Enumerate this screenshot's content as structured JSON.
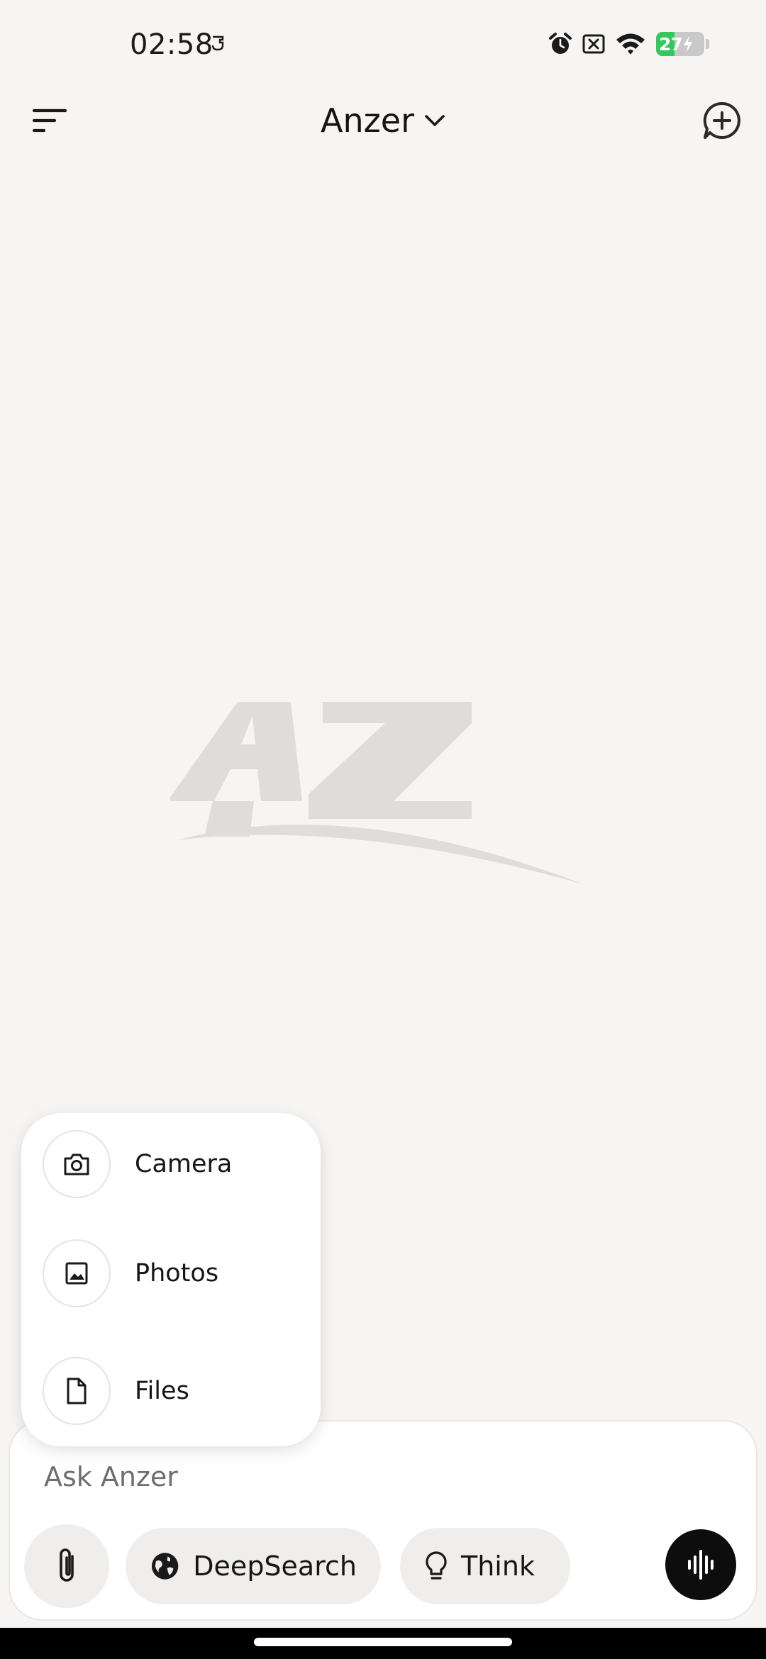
{
  "status_bar": {
    "time": "02:58",
    "battery_level": "27",
    "icons": [
      "alarm-icon",
      "no-sim-icon",
      "wifi-icon",
      "battery-charging-icon"
    ]
  },
  "header": {
    "title": "Anzer",
    "menu_icon": "sort-menu-icon",
    "new_chat_icon": "new-chat-icon"
  },
  "logo": {
    "text": "AZ"
  },
  "attach_menu": {
    "items": [
      {
        "label": "Camera",
        "icon": "camera-icon"
      },
      {
        "label": "Photos",
        "icon": "image-icon"
      },
      {
        "label": "Files",
        "icon": "file-icon"
      }
    ]
  },
  "composer": {
    "placeholder": "Ask Anzer",
    "deepsearch_label": "DeepSearch",
    "think_label": "Think",
    "attach_icon": "paperclip-icon",
    "voice_icon": "voice-wave-icon"
  },
  "colors": {
    "background": "#f6f5f3",
    "surface": "#ffffff",
    "pill": "#efeeec",
    "voice_button": "#0d0d0d",
    "battery_green": "#34c759"
  }
}
